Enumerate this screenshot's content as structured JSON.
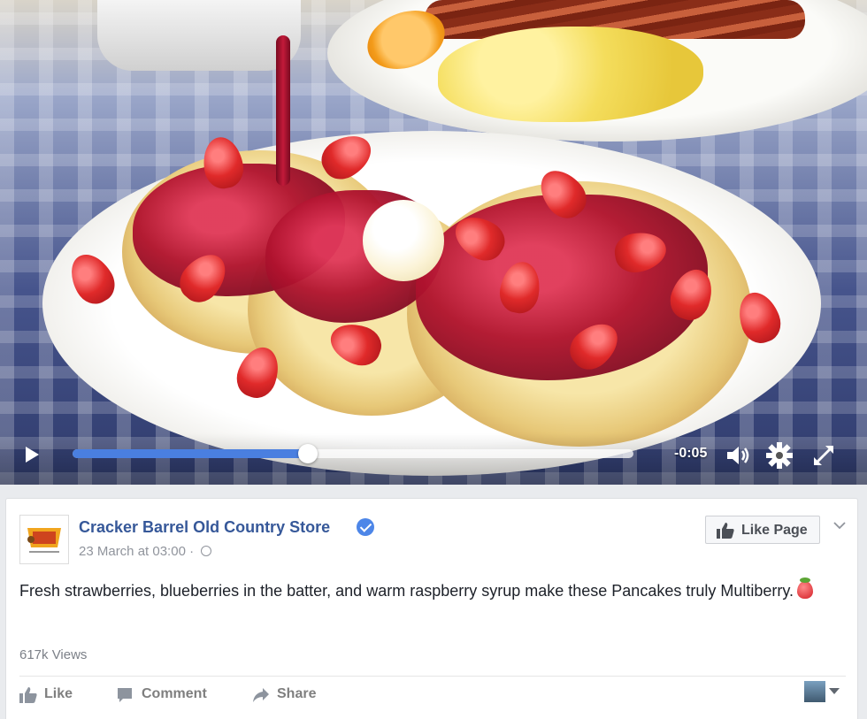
{
  "video": {
    "time_remaining": "-0:05",
    "progress": 0.42
  },
  "post": {
    "page_name": "Cracker Barrel Old Country Store",
    "timestamp": "23 March at 03:00 · ",
    "like_page_label": "Like Page",
    "text": "Fresh strawberries, blueberries in the batter, and warm raspberry syrup make these Pancakes truly Multiberry.",
    "views": "617k Views",
    "actions": {
      "like": "Like",
      "comment": "Comment",
      "share": "Share"
    }
  },
  "colors": {
    "link": "#365899",
    "progress": "#4a7fe0",
    "verified": "#4d86e8"
  },
  "icons": [
    "play-icon",
    "volume-icon",
    "gear-icon",
    "fullscreen-icon",
    "verified-icon",
    "globe-icon",
    "thumbs-up-icon",
    "chevron-down-icon",
    "comment-icon",
    "share-icon",
    "strawberry-emoji"
  ]
}
